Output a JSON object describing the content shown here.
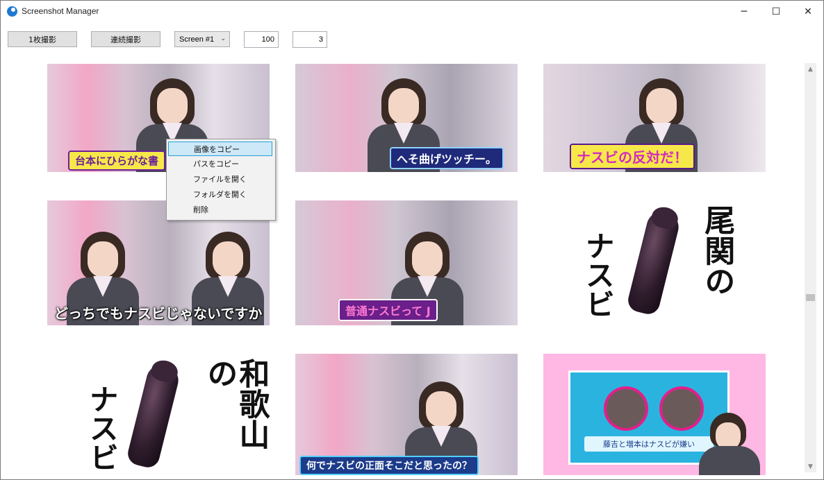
{
  "window": {
    "title": "Screenshot Manager"
  },
  "titlebar": {
    "minimize_icon": "minimize-icon",
    "maximize_icon": "maximize-icon",
    "close_icon": "close-icon",
    "min_glyph": "─",
    "max_glyph": "☐",
    "close_glyph": "✕"
  },
  "toolbar": {
    "single_shot_label": "1枚撮影",
    "continuous_shot_label": "連続撮影",
    "screen_select_value": "Screen #1",
    "select_caret": "⌄",
    "interval_value": "100",
    "count_value": "3"
  },
  "gallery": {
    "captions": {
      "t1": "台本にひらがな書",
      "t2": "へそ曲げツッチー。",
      "t3": "ナスビの反対だ！",
      "t4": "どっちでもナスビじゃないですか",
      "t5": "普通ナスビって J",
      "t6_line1": "尾関の",
      "t6_line2": "ナスビ",
      "t7_line1": "和歌山の",
      "t7_line2": "ナスビ",
      "t8": "何でナスビの正面そこだと思ったの？",
      "t9": "藤吉と増本はナスビが嫌い"
    }
  },
  "context_menu": {
    "items": [
      "画像をコピー",
      "パスをコピー",
      "ファイルを開く",
      "フォルダを開く",
      "削除"
    ]
  },
  "scrollbar": {
    "up_glyph": "▲",
    "down_glyph": "▼"
  }
}
